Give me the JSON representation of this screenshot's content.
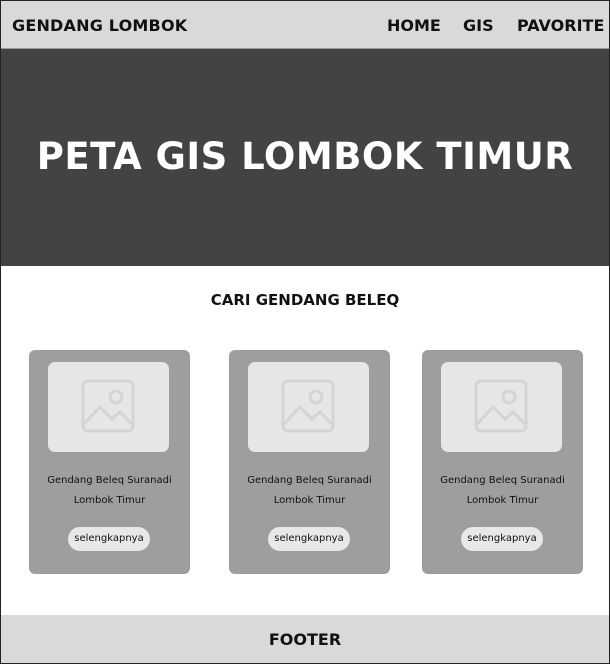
{
  "navbar": {
    "brand": "GENDANG LOMBOK",
    "links": [
      "HOME",
      "GIS",
      "PAVORITE"
    ]
  },
  "hero": {
    "title": "PETA GIS LOMBOK TIMUR"
  },
  "section": {
    "title": "CARI GENDANG BELEQ"
  },
  "cards": [
    {
      "name_line1": "Gendang Beleq Suranadi",
      "name_line2": "Lombok Timur",
      "button": "selengkapnya",
      "image_icon": "image-placeholder-icon"
    },
    {
      "name_line1": "Gendang Beleq Suranadi",
      "name_line2": "Lombok Timur",
      "button": "selengkapnya",
      "image_icon": "image-placeholder-icon"
    },
    {
      "name_line1": "Gendang Beleq Suranadi",
      "name_line2": "Lombok Timur",
      "button": "selengkapnya",
      "image_icon": "image-placeholder-icon"
    }
  ],
  "footer": {
    "text": "FOOTER"
  },
  "colors": {
    "navbar_bg": "#d9d9d9",
    "hero_bg": "#434343",
    "card_bg": "#9e9e9e",
    "image_bg": "#e6e6e6",
    "button_bg": "#e8e8e8",
    "footer_bg": "#d9d9d9"
  }
}
